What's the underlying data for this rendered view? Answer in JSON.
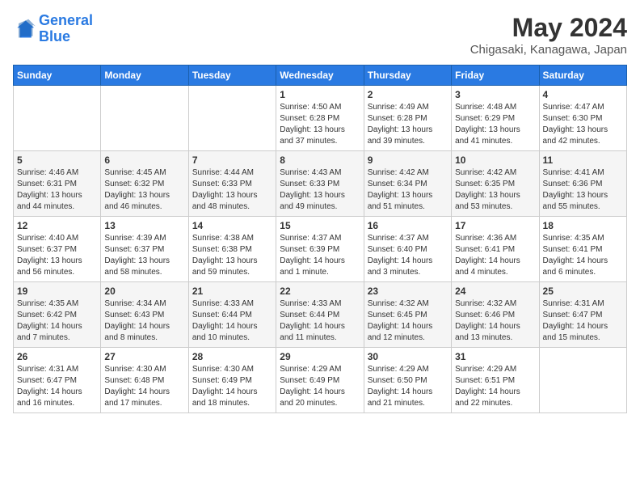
{
  "logo": {
    "line1": "General",
    "line2": "Blue"
  },
  "title": "May 2024",
  "subtitle": "Chigasaki, Kanagawa, Japan",
  "header": {
    "days": [
      "Sunday",
      "Monday",
      "Tuesday",
      "Wednesday",
      "Thursday",
      "Friday",
      "Saturday"
    ]
  },
  "weeks": [
    {
      "cells": [
        {
          "day": "",
          "info": ""
        },
        {
          "day": "",
          "info": ""
        },
        {
          "day": "",
          "info": ""
        },
        {
          "day": "1",
          "info": "Sunrise: 4:50 AM\nSunset: 6:28 PM\nDaylight: 13 hours and 37 minutes."
        },
        {
          "day": "2",
          "info": "Sunrise: 4:49 AM\nSunset: 6:28 PM\nDaylight: 13 hours and 39 minutes."
        },
        {
          "day": "3",
          "info": "Sunrise: 4:48 AM\nSunset: 6:29 PM\nDaylight: 13 hours and 41 minutes."
        },
        {
          "day": "4",
          "info": "Sunrise: 4:47 AM\nSunset: 6:30 PM\nDaylight: 13 hours and 42 minutes."
        }
      ]
    },
    {
      "cells": [
        {
          "day": "5",
          "info": "Sunrise: 4:46 AM\nSunset: 6:31 PM\nDaylight: 13 hours and 44 minutes."
        },
        {
          "day": "6",
          "info": "Sunrise: 4:45 AM\nSunset: 6:32 PM\nDaylight: 13 hours and 46 minutes."
        },
        {
          "day": "7",
          "info": "Sunrise: 4:44 AM\nSunset: 6:33 PM\nDaylight: 13 hours and 48 minutes."
        },
        {
          "day": "8",
          "info": "Sunrise: 4:43 AM\nSunset: 6:33 PM\nDaylight: 13 hours and 49 minutes."
        },
        {
          "day": "9",
          "info": "Sunrise: 4:42 AM\nSunset: 6:34 PM\nDaylight: 13 hours and 51 minutes."
        },
        {
          "day": "10",
          "info": "Sunrise: 4:42 AM\nSunset: 6:35 PM\nDaylight: 13 hours and 53 minutes."
        },
        {
          "day": "11",
          "info": "Sunrise: 4:41 AM\nSunset: 6:36 PM\nDaylight: 13 hours and 55 minutes."
        }
      ]
    },
    {
      "cells": [
        {
          "day": "12",
          "info": "Sunrise: 4:40 AM\nSunset: 6:37 PM\nDaylight: 13 hours and 56 minutes."
        },
        {
          "day": "13",
          "info": "Sunrise: 4:39 AM\nSunset: 6:37 PM\nDaylight: 13 hours and 58 minutes."
        },
        {
          "day": "14",
          "info": "Sunrise: 4:38 AM\nSunset: 6:38 PM\nDaylight: 13 hours and 59 minutes."
        },
        {
          "day": "15",
          "info": "Sunrise: 4:37 AM\nSunset: 6:39 PM\nDaylight: 14 hours and 1 minute."
        },
        {
          "day": "16",
          "info": "Sunrise: 4:37 AM\nSunset: 6:40 PM\nDaylight: 14 hours and 3 minutes."
        },
        {
          "day": "17",
          "info": "Sunrise: 4:36 AM\nSunset: 6:41 PM\nDaylight: 14 hours and 4 minutes."
        },
        {
          "day": "18",
          "info": "Sunrise: 4:35 AM\nSunset: 6:41 PM\nDaylight: 14 hours and 6 minutes."
        }
      ]
    },
    {
      "cells": [
        {
          "day": "19",
          "info": "Sunrise: 4:35 AM\nSunset: 6:42 PM\nDaylight: 14 hours and 7 minutes."
        },
        {
          "day": "20",
          "info": "Sunrise: 4:34 AM\nSunset: 6:43 PM\nDaylight: 14 hours and 8 minutes."
        },
        {
          "day": "21",
          "info": "Sunrise: 4:33 AM\nSunset: 6:44 PM\nDaylight: 14 hours and 10 minutes."
        },
        {
          "day": "22",
          "info": "Sunrise: 4:33 AM\nSunset: 6:44 PM\nDaylight: 14 hours and 11 minutes."
        },
        {
          "day": "23",
          "info": "Sunrise: 4:32 AM\nSunset: 6:45 PM\nDaylight: 14 hours and 12 minutes."
        },
        {
          "day": "24",
          "info": "Sunrise: 4:32 AM\nSunset: 6:46 PM\nDaylight: 14 hours and 13 minutes."
        },
        {
          "day": "25",
          "info": "Sunrise: 4:31 AM\nSunset: 6:47 PM\nDaylight: 14 hours and 15 minutes."
        }
      ]
    },
    {
      "cells": [
        {
          "day": "26",
          "info": "Sunrise: 4:31 AM\nSunset: 6:47 PM\nDaylight: 14 hours and 16 minutes."
        },
        {
          "day": "27",
          "info": "Sunrise: 4:30 AM\nSunset: 6:48 PM\nDaylight: 14 hours and 17 minutes."
        },
        {
          "day": "28",
          "info": "Sunrise: 4:30 AM\nSunset: 6:49 PM\nDaylight: 14 hours and 18 minutes."
        },
        {
          "day": "29",
          "info": "Sunrise: 4:29 AM\nSunset: 6:49 PM\nDaylight: 14 hours and 20 minutes."
        },
        {
          "day": "30",
          "info": "Sunrise: 4:29 AM\nSunset: 6:50 PM\nDaylight: 14 hours and 21 minutes."
        },
        {
          "day": "31",
          "info": "Sunrise: 4:29 AM\nSunset: 6:51 PM\nDaylight: 14 hours and 22 minutes."
        },
        {
          "day": "",
          "info": ""
        }
      ]
    }
  ]
}
